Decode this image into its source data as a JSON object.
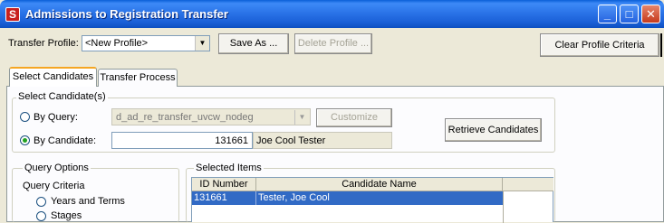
{
  "window": {
    "title": "Admissions to Registration Transfer",
    "icon_letter": "S",
    "minimize": "_",
    "maximize": "□",
    "close": "✕"
  },
  "toolbar": {
    "profile_label": "Transfer Profile:",
    "profile_value": "<New Profile>",
    "save_as_label": "Save As ...",
    "delete_label": "Delete Profile ...",
    "clear_label": "Clear Profile Criteria"
  },
  "tabs": [
    {
      "label": "Select Candidates",
      "active": true
    },
    {
      "label": "Transfer Process",
      "active": false
    }
  ],
  "select_candidates": {
    "group_title": "Select Candidate(s)",
    "by_query_label": "By Query:",
    "query_value": "d_ad_re_transfer_uvcw_nodeg",
    "customize_label": "Customize",
    "by_candidate_label": "By Candidate:",
    "candidate_id": "131661",
    "candidate_name": "Joe Cool Tester",
    "retrieve_label": "Retrieve Candidates"
  },
  "query_options": {
    "group_title": "Query Options",
    "criteria_label": "Query Criteria",
    "options": [
      "Years and Terms",
      "Stages"
    ]
  },
  "selected_items": {
    "group_title": "Selected Items",
    "columns": [
      "ID Number",
      "Candidate Name"
    ],
    "rows": [
      {
        "id": "131661",
        "name": "Tester, Joe Cool"
      }
    ]
  }
}
